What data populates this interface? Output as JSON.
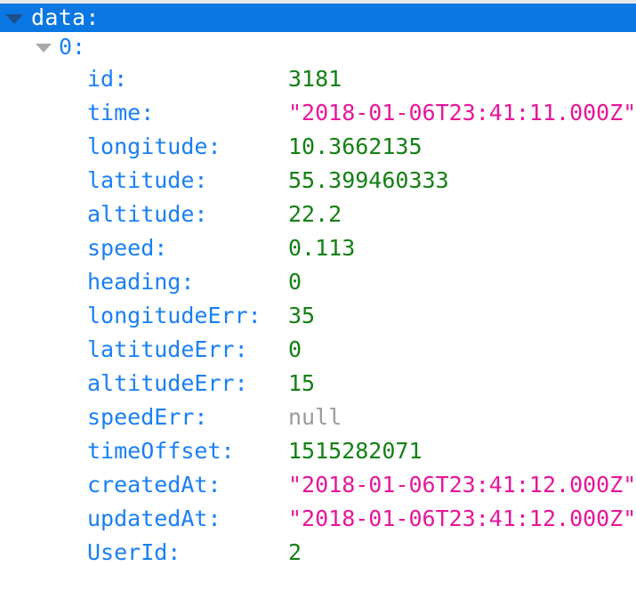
{
  "viewer": {
    "root": {
      "label": "data:",
      "expanded": true,
      "selected": true,
      "triangle_icon": "triangle-down-icon"
    },
    "index_node": {
      "label": "0:",
      "expanded": true,
      "triangle_icon": "triangle-down-icon"
    },
    "entries": [
      {
        "key": "id:",
        "value": "3181",
        "type": "number"
      },
      {
        "key": "time:",
        "value": "\"2018-01-06T23:41:11.000Z\"",
        "type": "string"
      },
      {
        "key": "longitude:",
        "value": "10.3662135",
        "type": "number"
      },
      {
        "key": "latitude:",
        "value": "55.399460333",
        "type": "number"
      },
      {
        "key": "altitude:",
        "value": "22.2",
        "type": "number"
      },
      {
        "key": "speed:",
        "value": "0.113",
        "type": "number"
      },
      {
        "key": "heading:",
        "value": "0",
        "type": "number"
      },
      {
        "key": "longitudeErr:",
        "value": "35",
        "type": "number"
      },
      {
        "key": "latitudeErr:",
        "value": "0",
        "type": "number"
      },
      {
        "key": "altitudeErr:",
        "value": "15",
        "type": "number"
      },
      {
        "key": "speedErr:",
        "value": "null",
        "type": "null"
      },
      {
        "key": "timeOffset:",
        "value": "1515282071",
        "type": "number"
      },
      {
        "key": "createdAt:",
        "value": "\"2018-01-06T23:41:12.000Z\"",
        "type": "string"
      },
      {
        "key": "updatedAt:",
        "value": "\"2018-01-06T23:41:12.000Z\"",
        "type": "string"
      },
      {
        "key": "UserId:",
        "value": "2",
        "type": "number"
      }
    ]
  },
  "colors": {
    "selection_bar": "#0a77e3",
    "key": "#1a7ff5",
    "number": "#148014",
    "string": "#e6169b",
    "null": "#9b9b9b",
    "background": "#ffffff",
    "scroll_strip": "#e8e8e8"
  }
}
